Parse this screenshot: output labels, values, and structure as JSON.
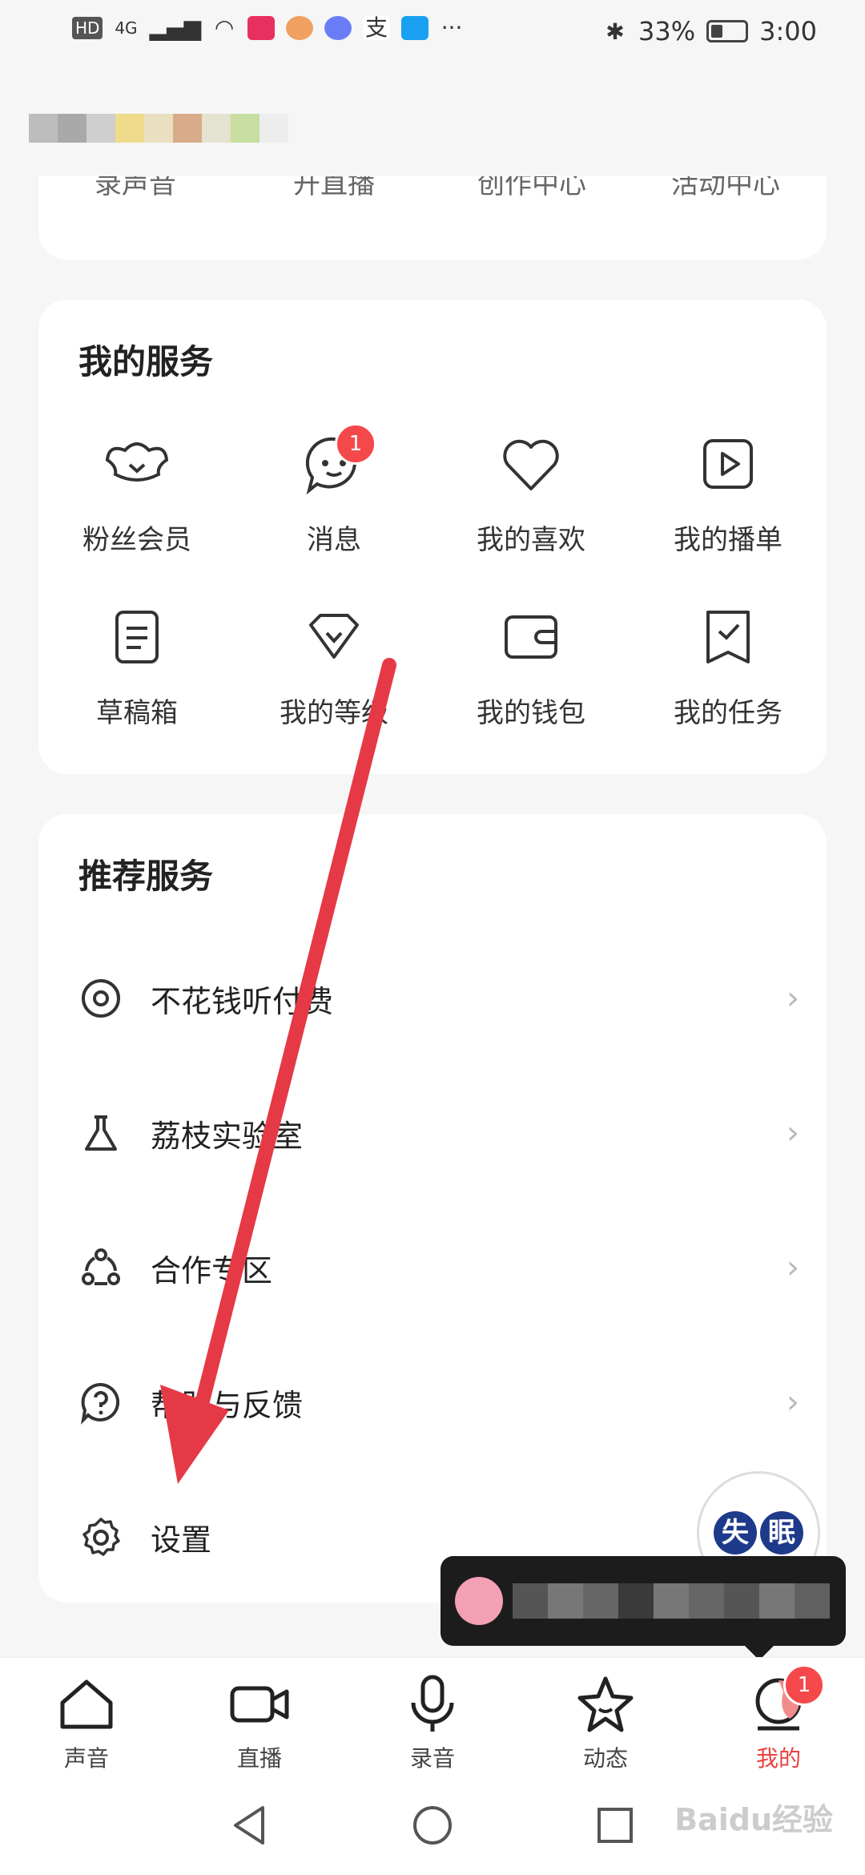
{
  "status_bar": {
    "hd": "HD",
    "network": "4G",
    "bluetooth": "✱",
    "battery_text": "33%",
    "time": "3:00",
    "more": "···"
  },
  "top_card_cut_labels": [
    "录声音",
    "开直播",
    "创作中心",
    "活动中心"
  ],
  "my_services": {
    "title": "我的服务",
    "items": [
      {
        "label": "粉丝会员",
        "icon": "fan-member-icon"
      },
      {
        "label": "消息",
        "icon": "message-icon",
        "badge": "1"
      },
      {
        "label": "我的喜欢",
        "icon": "heart-icon"
      },
      {
        "label": "我的播单",
        "icon": "playlist-icon"
      },
      {
        "label": "草稿箱",
        "icon": "draft-icon"
      },
      {
        "label": "我的等级",
        "icon": "level-icon"
      },
      {
        "label": "我的钱包",
        "icon": "wallet-icon"
      },
      {
        "label": "我的任务",
        "icon": "task-icon"
      }
    ]
  },
  "recommended": {
    "title": "推荐服务",
    "items": [
      {
        "label": "不花钱听付费",
        "icon": "disc-icon"
      },
      {
        "label": "荔枝实验室",
        "icon": "flask-icon"
      },
      {
        "label": "合作专区",
        "icon": "cooperation-icon"
      },
      {
        "label": "帮助与反馈",
        "icon": "help-icon"
      },
      {
        "label": "设置",
        "icon": "gear-icon"
      }
    ]
  },
  "floater": {
    "c1": "失",
    "c2": "眠"
  },
  "bottom_nav": [
    {
      "label": "声音",
      "icon": "home-icon"
    },
    {
      "label": "直播",
      "icon": "video-icon"
    },
    {
      "label": "录音",
      "icon": "mic-icon"
    },
    {
      "label": "动态",
      "icon": "star-icon"
    },
    {
      "label": "我的",
      "icon": "profile-icon",
      "badge": "1",
      "active": true
    }
  ],
  "watermark": "Baidu经验",
  "colors": {
    "accent": "#e8423f",
    "badge": "#f5484a",
    "arrow": "#e63946"
  }
}
